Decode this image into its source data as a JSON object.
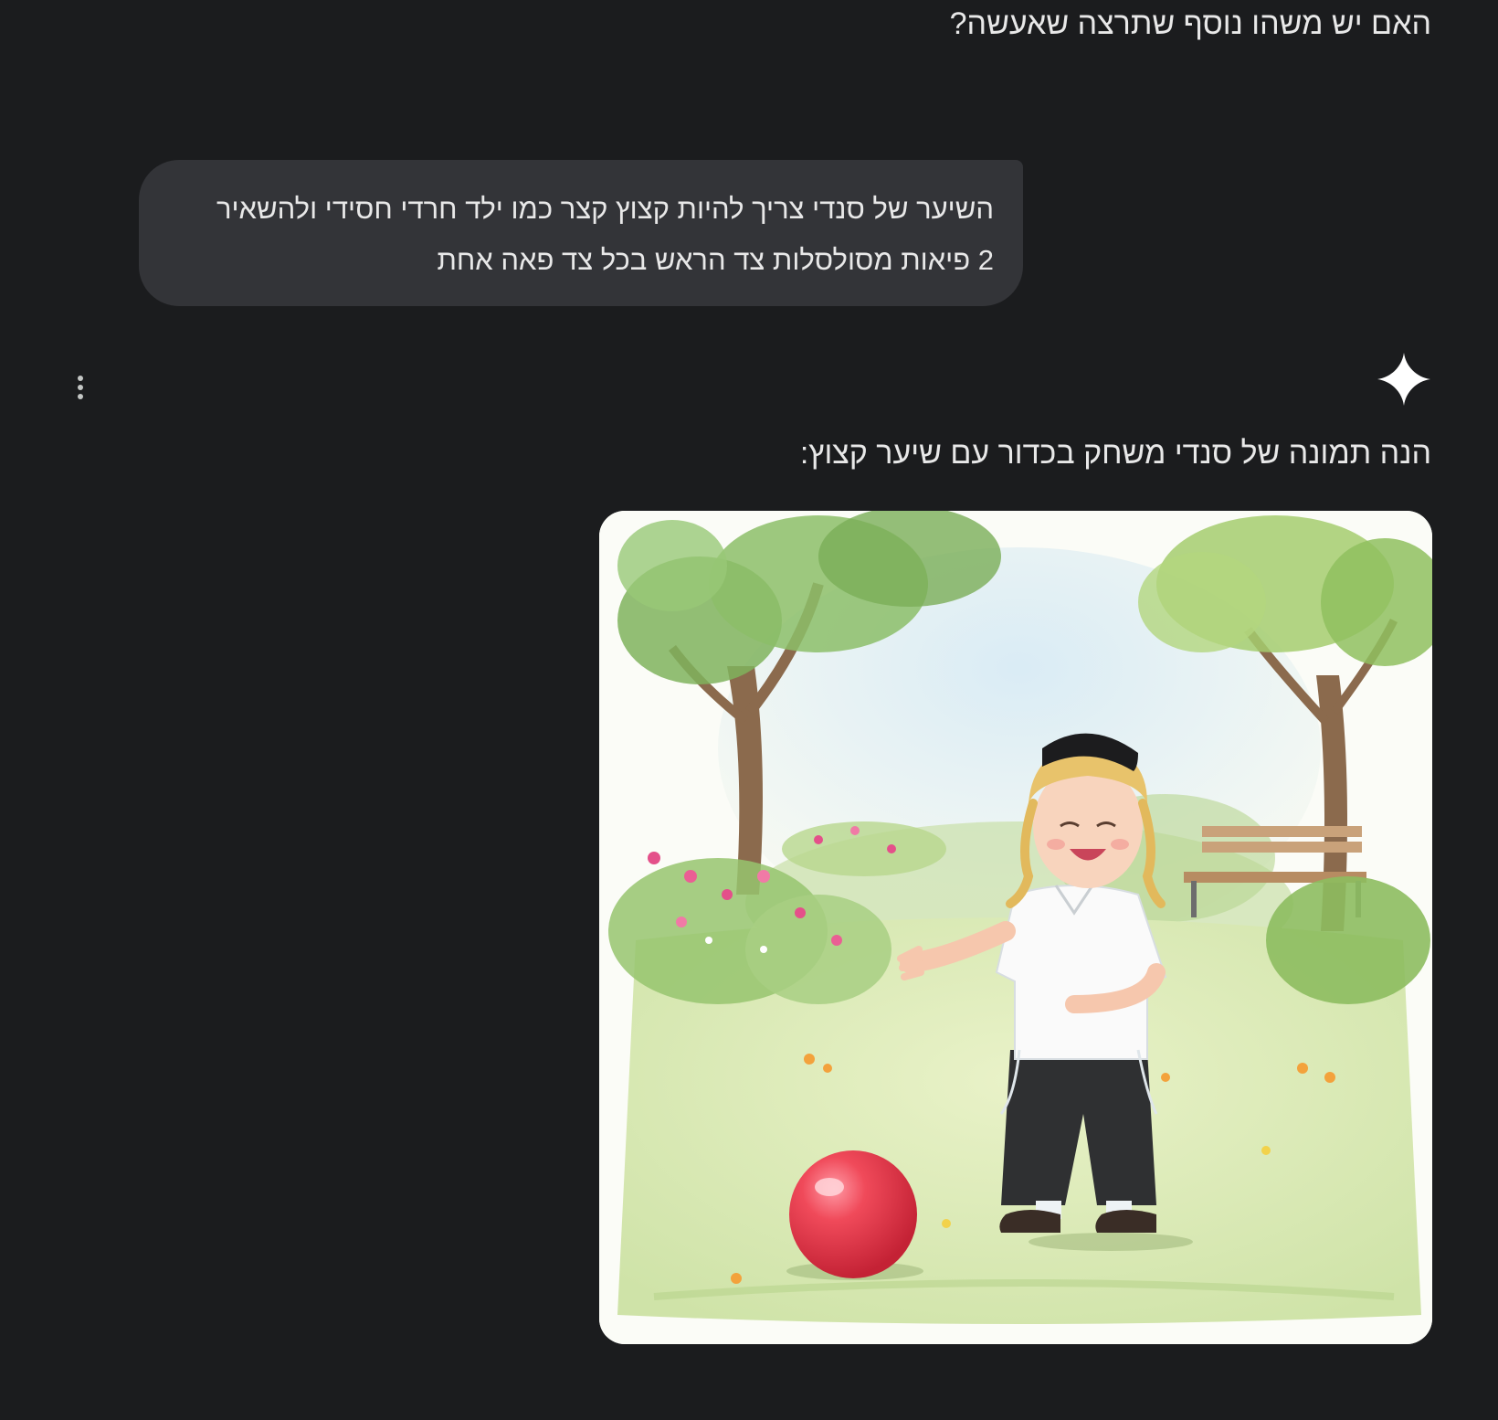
{
  "conversation": {
    "previous_assistant_text": "האם יש משהו נוסף שתרצה שאעשה?",
    "user_message": {
      "line1": "השיער של סנדי צריך להיות קצוץ קצר כמו ילד חרדי חסידי ולהשאיר",
      "line2": "2 פיאות מסולסלות צד הראש בכל צד פאה אחת"
    },
    "assistant_reply": {
      "icon": "gemini-sparkle-icon",
      "text": "הנה תמונה של סנדי משחק בכדור עם שיער קצוץ:",
      "image_subject": "boy-playing-ball-in-park"
    },
    "actions": {
      "more_icon": "more-vert-icon"
    }
  },
  "colors": {
    "background": "#1b1c1e",
    "bubble": "#333438",
    "text": "#e8e8e8",
    "ball": "#e8404e"
  }
}
